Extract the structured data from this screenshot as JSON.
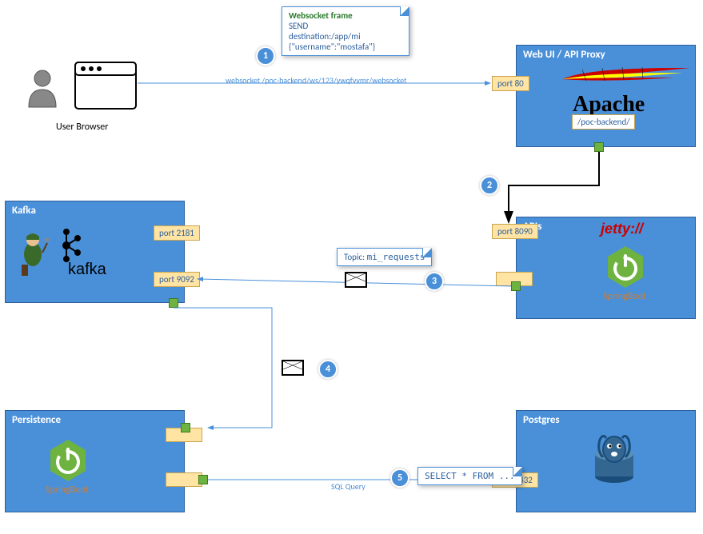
{
  "boxes": {
    "apache": {
      "title": "Web UI / API Proxy",
      "brand": "Apache",
      "port": "port 80",
      "proxy_path": "/poc-backend/"
    },
    "apis": {
      "title": "APIs",
      "brand_jetty": "jetty://",
      "port": "port 8090",
      "framework": "SpringBoot"
    },
    "kafka": {
      "title": "Kafka",
      "port1": "port 2181",
      "port2": "port 9092",
      "brand": "kafka"
    },
    "persistence": {
      "title": "Persistence",
      "framework": "SpringBoot"
    },
    "postgres": {
      "title": "Postgres",
      "port": "port 5432"
    }
  },
  "user_browser_label": "User Browser",
  "notes": {
    "ws_frame_title": "Websocket frame",
    "ws_line1": "SEND",
    "ws_line2": "destination:/app/mi",
    "ws_line3": "{\"username\":\"mostafa\"}",
    "topic_label": "Topic:",
    "topic_value": "mi_requests",
    "sql": "SELECT * FROM ..."
  },
  "labels": {
    "ws_url": "websocket /poc-backend/ws/123/ywqfvvmr/websocket",
    "sql_query": "SQL Query"
  },
  "steps": {
    "s1": "1",
    "s2": "2",
    "s3": "3",
    "s4": "4",
    "s5": "5"
  }
}
